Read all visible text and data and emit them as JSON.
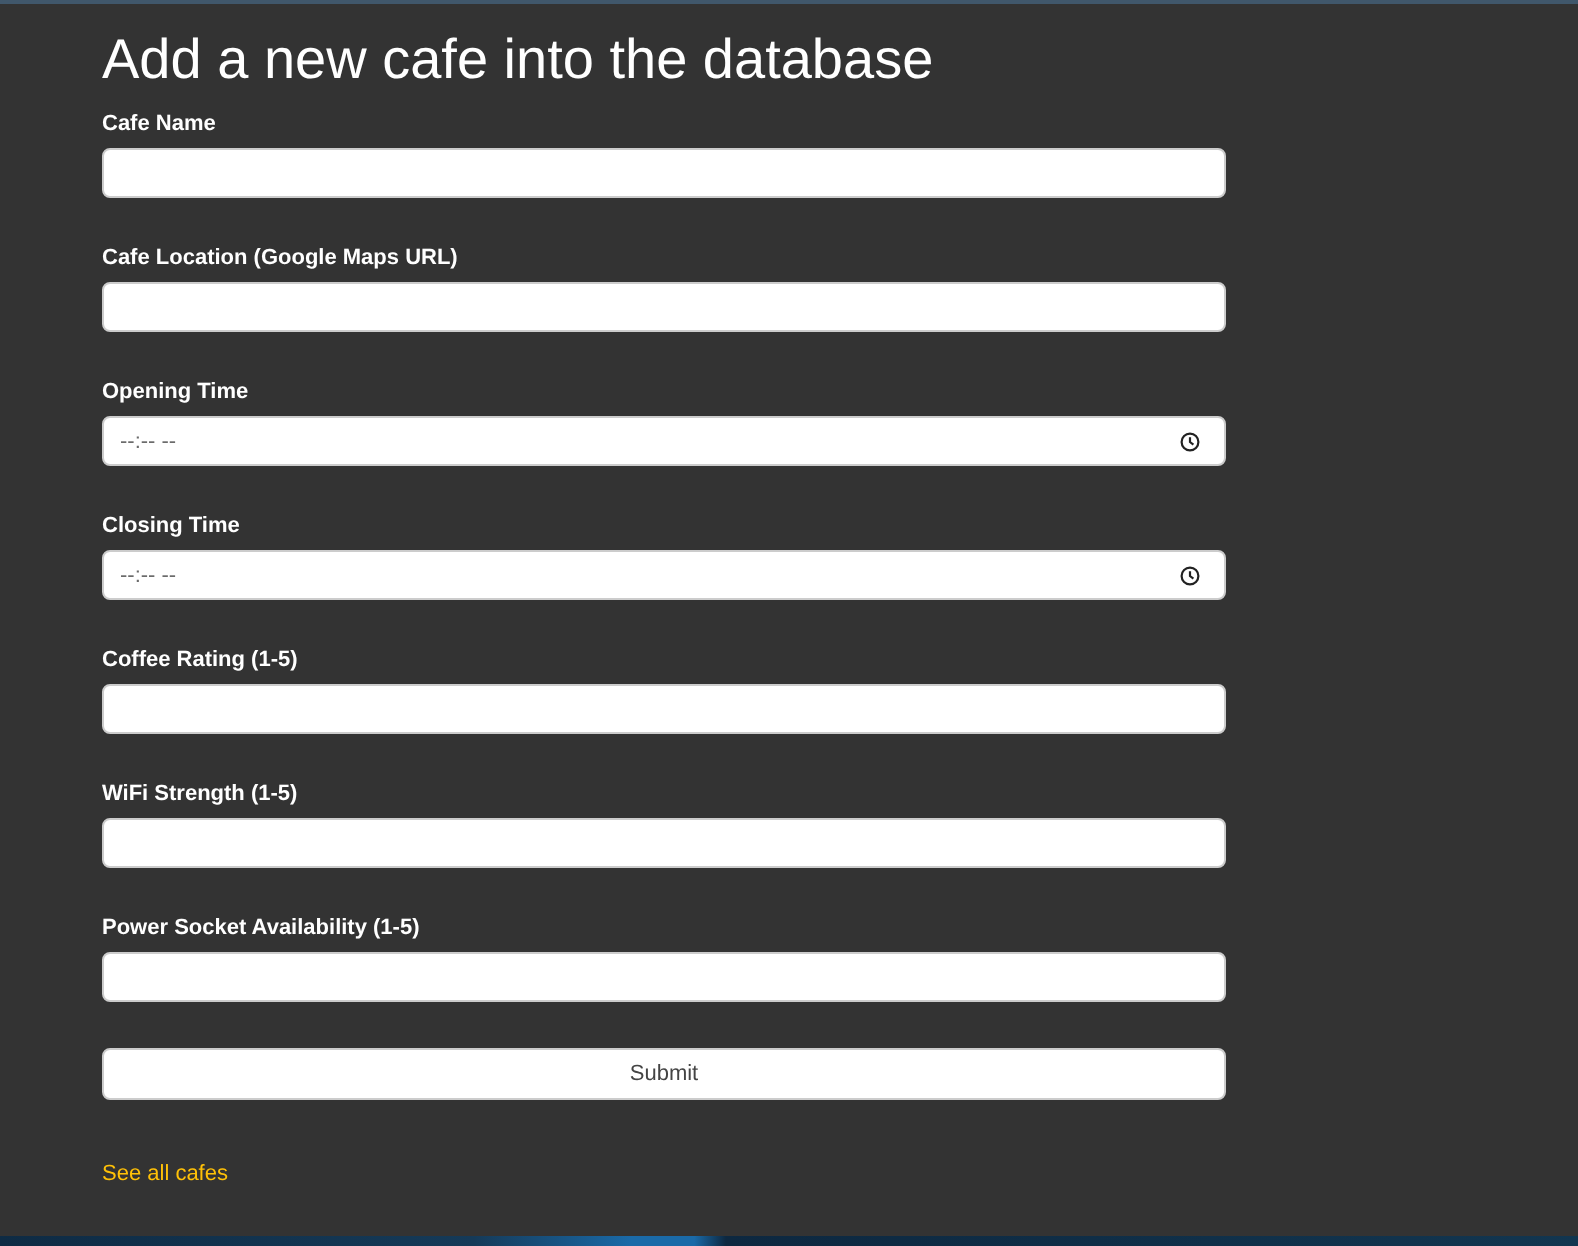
{
  "heading": "Add a new cafe into the database",
  "fields": [
    {
      "label": "Cafe Name",
      "kind": "text"
    },
    {
      "label": "Cafe Location (Google Maps URL)",
      "kind": "text"
    },
    {
      "label": "Opening Time",
      "kind": "time",
      "placeholder": "--:-- --"
    },
    {
      "label": "Closing Time",
      "kind": "time",
      "placeholder": "--:-- --"
    },
    {
      "label": "Coffee Rating (1-5)",
      "kind": "text"
    },
    {
      "label": "WiFi Strength (1-5)",
      "kind": "text"
    },
    {
      "label": "Power Socket Availability (1-5)",
      "kind": "text"
    }
  ],
  "submit_button": {
    "label": "Submit"
  },
  "link": {
    "label": "See all cafes"
  }
}
